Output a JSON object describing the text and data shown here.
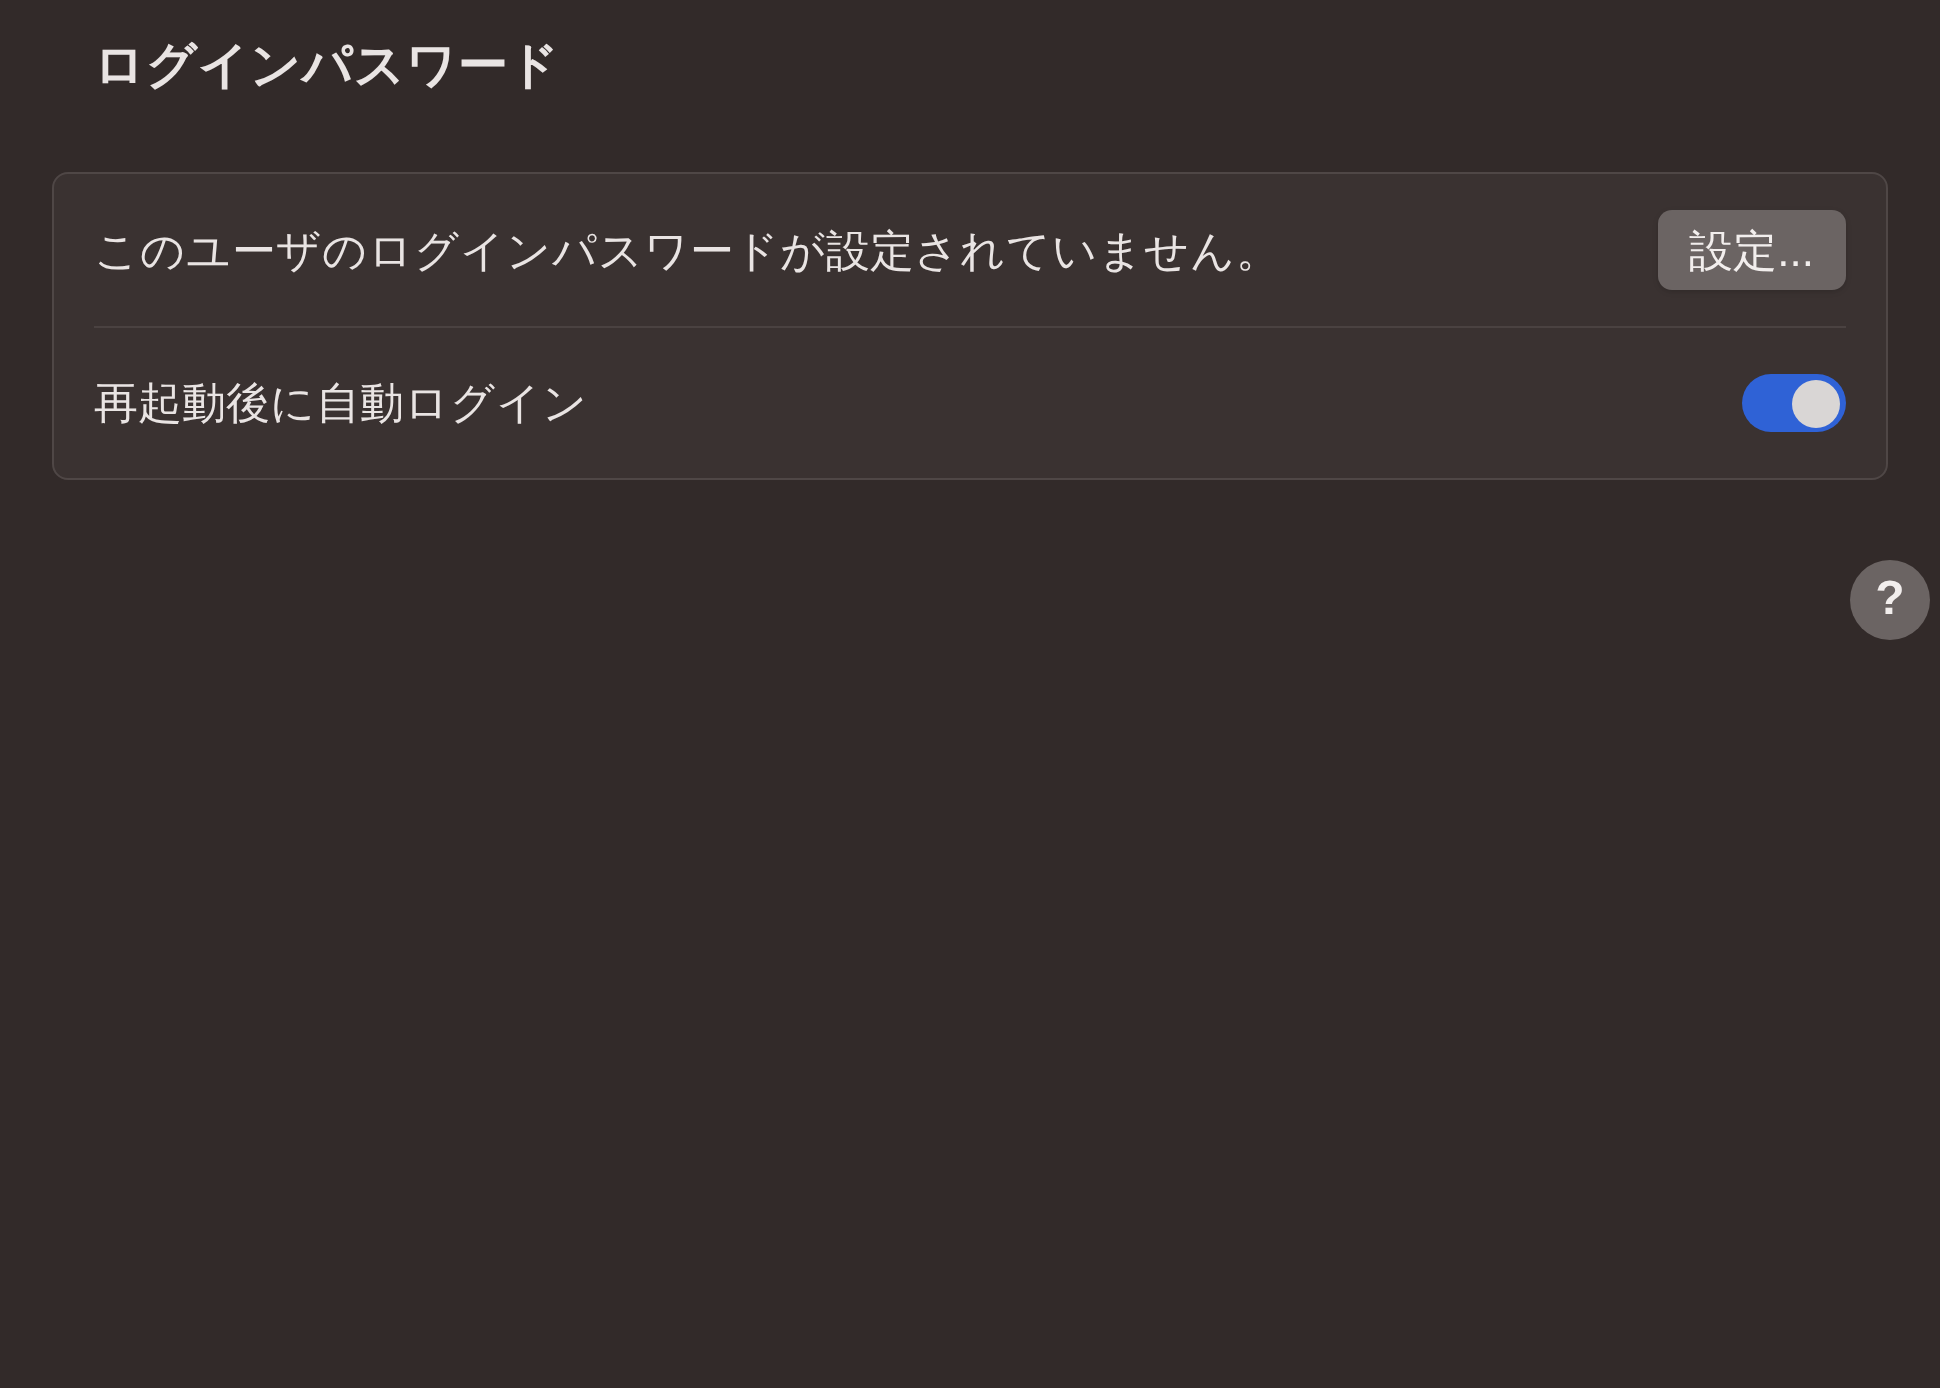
{
  "title": "ログインパスワード",
  "rows": [
    {
      "kind": "button",
      "label": "このユーザのログインパスワードが設定されていません。",
      "button": "設定..."
    },
    {
      "kind": "toggle",
      "label": "再起動後に自動ログイン",
      "on": true
    }
  ],
  "help": "?"
}
